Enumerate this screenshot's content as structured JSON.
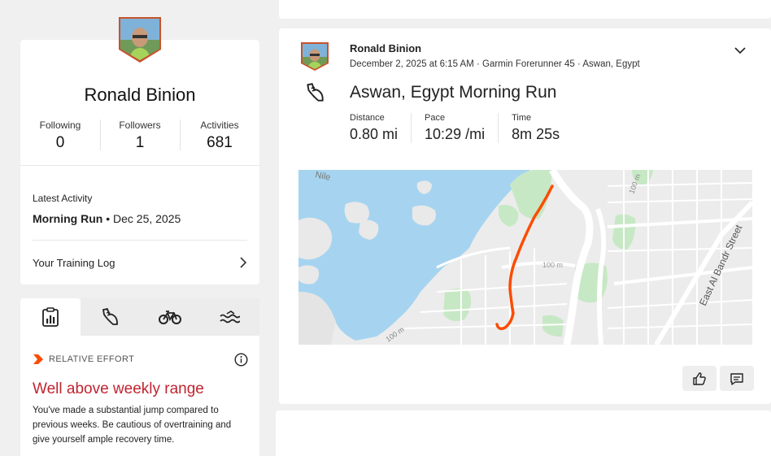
{
  "profile": {
    "name": "Ronald Binion",
    "stats": [
      {
        "label": "Following",
        "value": "0"
      },
      {
        "label": "Followers",
        "value": "1"
      },
      {
        "label": "Activities",
        "value": "681"
      }
    ],
    "latest_activity": {
      "label": "Latest Activity",
      "name": "Morning Run",
      "date": " • Dec 25, 2025"
    },
    "training_log_label": "Your Training Log"
  },
  "sport_tabs": [
    {
      "icon": "stats-clipboard-icon",
      "active": true
    },
    {
      "icon": "shoe-icon",
      "active": false
    },
    {
      "icon": "bike-icon",
      "active": false
    },
    {
      "icon": "swim-icon",
      "active": false
    }
  ],
  "relative_effort": {
    "header": "RELATIVE EFFORT",
    "title": "Well above weekly range",
    "description": "You've made a substantial jump compared to previous weeks. Be cautious of overtraining and give yourself ample recovery time.",
    "title_color": "#c0242f",
    "accent_color": "#fc4c02"
  },
  "activity": {
    "athlete_name": "Ronald Binion",
    "meta": "December 2, 2025 at 6:15 AM · Garmin Forerunner 45 · Aswan, Egypt",
    "title": "Aswan, Egypt Morning Run",
    "metrics": [
      {
        "label": "Distance",
        "value": "0.80 mi"
      },
      {
        "label": "Pace",
        "value": "10:29 /mi"
      },
      {
        "label": "Time",
        "value": "8m 25s"
      }
    ],
    "map": {
      "labels": {
        "river": "Nile",
        "street": "East Al Bandr Street",
        "elev1": "100 m",
        "elev2": "100 m",
        "elev3": "100 m"
      },
      "route_color": "#fc4c02",
      "water_color": "#a6d4f0",
      "park_color": "#c7e8c4"
    }
  }
}
